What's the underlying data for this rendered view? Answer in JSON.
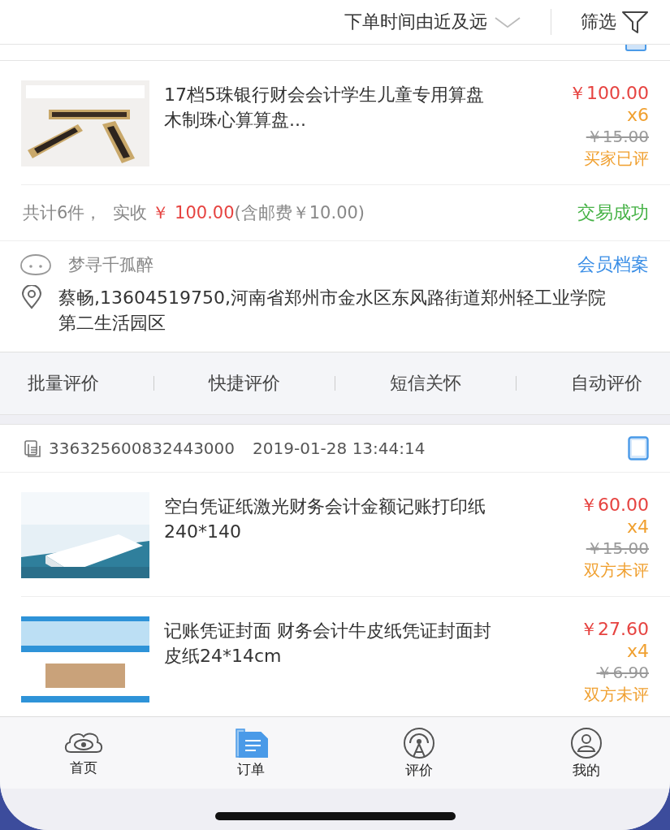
{
  "toolbar": {
    "sort": "下单时间由近及远",
    "filter": "筛选"
  },
  "orders": [
    {
      "items": [
        {
          "kind": "picture",
          "title": "17档5珠银行财会会计学生儿童专用算盘木制珠心算算盘...",
          "price": "￥100.00",
          "quantity": "x6",
          "original_price": "￥15.00",
          "review_status": "买家已评"
        }
      ],
      "summary": {
        "count": "共计6件，",
        "paid_label": "实收",
        "paid": "￥ 100.00",
        "postage": "(含邮费￥10.00)"
      },
      "status": "交易成功",
      "buyer": {
        "nickname": "梦寻千孤醉",
        "profile_link": "会员档案",
        "address": "蔡畅,13604519750,河南省郑州市金水区东风路街道郑州轻工业学院第二生活园区"
      },
      "actions": [
        "批量评价",
        "快捷评价",
        "短信关怀",
        "自动评价"
      ]
    },
    {
      "order_no": "336325600832443000",
      "time": "2019-01-28 13:44:14",
      "items": [
        {
          "kind": "picture",
          "title": "空白凭证纸激光财务会计金额记账打印纸240*140",
          "price": "￥60.00",
          "quantity": "x4",
          "original_price": "￥15.00",
          "review_status": "双方未评"
        },
        {
          "kind": "picture",
          "title": "记账凭证封面 财务会计牛皮纸凭证封面封皮纸24*14cm",
          "price": "￥27.60",
          "quantity": "x4",
          "original_price": "￥6.90",
          "review_status": "双方未评"
        }
      ]
    }
  ],
  "tabs": [
    {
      "label": "首页",
      "selected": false
    },
    {
      "label": "订单",
      "selected": true
    },
    {
      "label": "评价",
      "selected": false
    },
    {
      "label": "我的",
      "selected": false
    }
  ]
}
